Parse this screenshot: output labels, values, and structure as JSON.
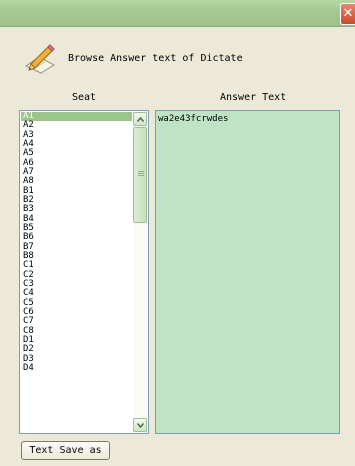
{
  "window": {
    "close_glyph": "✕"
  },
  "header": {
    "title": "Browse Answer text of Dictate",
    "icon": "pencil-paper-icon"
  },
  "columns": {
    "seat": "Seat",
    "answer": "Answer Text"
  },
  "seats": [
    "A1",
    "A2",
    "A3",
    "A4",
    "A5",
    "A6",
    "A7",
    "A8",
    "B1",
    "B2",
    "B3",
    "B4",
    "B5",
    "B6",
    "B7",
    "B8",
    "C1",
    "C2",
    "C3",
    "C4",
    "C5",
    "C6",
    "C7",
    "C8",
    "D1",
    "D2",
    "D3",
    "D4"
  ],
  "selected_seat": "A1",
  "answer_text": "wa2e43fcrwdes",
  "buttons": {
    "save_as": "Text Save as"
  },
  "colors": {
    "titlebar": "#a5c995",
    "selection": "#9cc58b",
    "answer_bg": "#c0e3c6",
    "window_bg": "#ece9d8"
  }
}
